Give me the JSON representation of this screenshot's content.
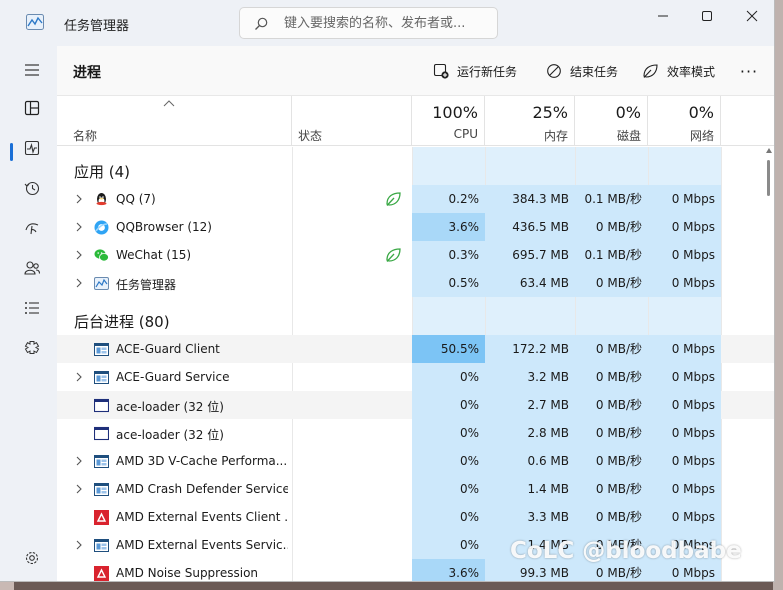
{
  "window": {
    "title": "任务管理器",
    "search_placeholder": "键入要搜索的名称、发布者或..."
  },
  "sidebar": {
    "items": [
      {
        "icon": "hamburger-icon"
      },
      {
        "icon": "processes-icon",
        "active": true
      },
      {
        "icon": "performance-icon"
      },
      {
        "icon": "app-history-icon"
      },
      {
        "icon": "startup-apps-icon"
      },
      {
        "icon": "users-icon"
      },
      {
        "icon": "details-icon"
      },
      {
        "icon": "services-icon"
      },
      {
        "icon": "settings-icon"
      }
    ]
  },
  "toolbar": {
    "page_title": "进程",
    "run_new_task": "运行新任务",
    "end_task": "结束任务",
    "efficiency_mode": "效率模式",
    "more": "···"
  },
  "columns": {
    "name": "名称",
    "status": "状态",
    "cpu_pct": "100%",
    "cpu": "CPU",
    "mem_pct": "25%",
    "mem": "内存",
    "disk_pct": "0%",
    "disk": "磁盘",
    "net_pct": "0%",
    "net": "网络"
  },
  "groups": {
    "apps": "应用 (4)",
    "background": "后台进程 (80)"
  },
  "apps": [
    {
      "name": "QQ (7)",
      "icon": "qq-icon",
      "expandable": true,
      "efficiency": true,
      "cpu": "0.2%",
      "mem": "384.3 MB",
      "disk": "0.1 MB/秒",
      "net": "0 Mbps"
    },
    {
      "name": "QQBrowser (12)",
      "icon": "qqbrowser-icon",
      "expandable": true,
      "efficiency": false,
      "cpu": "3.6%",
      "mem": "436.5 MB",
      "disk": "0 MB/秒",
      "net": "0 Mbps"
    },
    {
      "name": "WeChat (15)",
      "icon": "wechat-icon",
      "expandable": true,
      "efficiency": true,
      "cpu": "0.3%",
      "mem": "695.7 MB",
      "disk": "0.1 MB/秒",
      "net": "0 Mbps"
    },
    {
      "name": "任务管理器",
      "icon": "task-manager-icon",
      "expandable": true,
      "efficiency": false,
      "cpu": "0.5%",
      "mem": "63.4 MB",
      "disk": "0 MB/秒",
      "net": "0 Mbps"
    }
  ],
  "background": [
    {
      "name": "ACE-Guard Client",
      "icon": "window-app-icon",
      "expandable": false,
      "cpu": "50.5%",
      "mem": "172.2 MB",
      "disk": "0 MB/秒",
      "net": "0 Mbps"
    },
    {
      "name": "ACE-Guard Service",
      "icon": "window-app-icon",
      "expandable": true,
      "cpu": "0%",
      "mem": "3.2 MB",
      "disk": "0 MB/秒",
      "net": "0 Mbps"
    },
    {
      "name": "ace-loader (32 位)",
      "icon": "blank-window-icon",
      "expandable": false,
      "cpu": "0%",
      "mem": "2.7 MB",
      "disk": "0 MB/秒",
      "net": "0 Mbps"
    },
    {
      "name": "ace-loader (32 位)",
      "icon": "blank-window-icon",
      "expandable": false,
      "cpu": "0%",
      "mem": "2.8 MB",
      "disk": "0 MB/秒",
      "net": "0 Mbps"
    },
    {
      "name": "AMD 3D V-Cache Performa...",
      "icon": "window-app-icon",
      "expandable": true,
      "cpu": "0%",
      "mem": "0.6 MB",
      "disk": "0 MB/秒",
      "net": "0 Mbps"
    },
    {
      "name": "AMD Crash Defender Service",
      "icon": "window-app-icon",
      "expandable": true,
      "cpu": "0%",
      "mem": "1.4 MB",
      "disk": "0 MB/秒",
      "net": "0 Mbps"
    },
    {
      "name": "AMD External Events Client ...",
      "icon": "amd-icon",
      "expandable": false,
      "cpu": "0%",
      "mem": "3.3 MB",
      "disk": "0 MB/秒",
      "net": "0 Mbps"
    },
    {
      "name": "AMD External Events Servic...",
      "icon": "window-app-icon",
      "expandable": true,
      "cpu": "0%",
      "mem": "1.4 MB",
      "disk": "0 MB/秒",
      "net": "0 Mbps"
    },
    {
      "name": "AMD Noise Suppression",
      "icon": "amd-icon",
      "expandable": false,
      "cpu": "3.6%",
      "mem": "99.3 MB",
      "disk": "0 MB/秒",
      "net": "0 Mbps"
    }
  ],
  "watermark": "CoLC @bloodbabe",
  "colors": {
    "accent": "#1a6fd6",
    "heat_low": "#cde8fb",
    "heat_mid": "#a9d8f8",
    "heat_high": "#7cc4f5",
    "efficiency_green": "#3aa845",
    "amd_red": "#d9232e"
  }
}
